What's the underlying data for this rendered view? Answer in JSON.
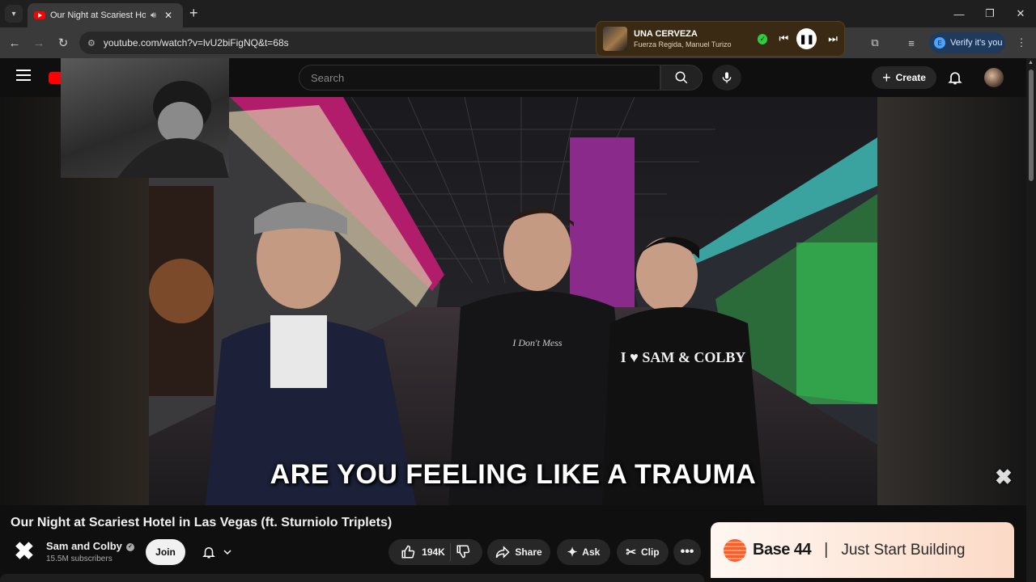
{
  "browser": {
    "tab_title": "Our Night at Scariest Hotel in Las Vegas (ft. Sturniolo Triplets)",
    "url": "youtube.com/watch?v=lvU2biFigNQ&t=68s",
    "verify_label": "Verify it's you",
    "verify_initial": "E"
  },
  "media_player": {
    "track_title": "UNA CERVEZA",
    "artists": "Fuerza Regida, Manuel Turizo",
    "state": "playing"
  },
  "youtube_header": {
    "search_placeholder": "Search",
    "create_label": "Create"
  },
  "video": {
    "subtitle": "ARE YOU FEELING LIKE A TRAUMA",
    "shirt_text": "I ♥ SAM & COLBY",
    "hoodie_text": "I Don't Mess"
  },
  "video_info": {
    "title": "Our Night at Scariest Hotel in Las Vegas (ft. Sturniolo Triplets)",
    "channel_name": "Sam and Colby",
    "subscribers": "15.5M subscribers",
    "join_label": "Join",
    "like_count": "194K",
    "share_label": "Share",
    "ask_label": "Ask",
    "clip_label": "Clip"
  },
  "ad": {
    "brand": "Base 44",
    "separator": "|",
    "tagline": "Just Start Building"
  },
  "colors": {
    "youtube_red": "#ff0000",
    "verify_bg": "#1f3a5c",
    "media_bg": "#3a2a14",
    "ad_accent": "#ff5a2a"
  }
}
